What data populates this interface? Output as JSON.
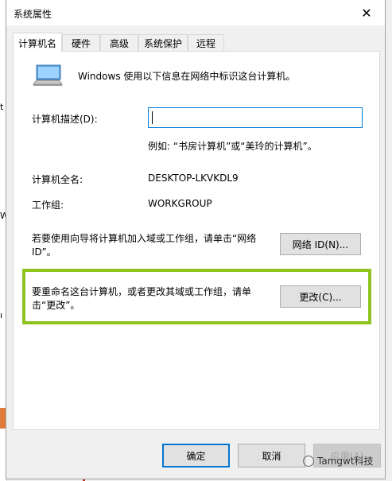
{
  "window": {
    "title": "系统属性",
    "close_glyph": "✕"
  },
  "tabs": [
    {
      "label": "计算机名",
      "active": true
    },
    {
      "label": "硬件",
      "active": false
    },
    {
      "label": "高级",
      "active": false
    },
    {
      "label": "系统保护",
      "active": false
    },
    {
      "label": "远程",
      "active": false
    }
  ],
  "panel": {
    "intro": "Windows 使用以下信息在网络中标识这台计算机。",
    "description_label": "计算机描述(D):",
    "description_value": "",
    "example": "例如: “书房计算机”或“美玲的计算机”。",
    "fullname_label": "计算机全名:",
    "fullname_value": "DESKTOP-LKVKDL9",
    "workgroup_label": "工作组:",
    "workgroup_value": "WORKGROUP",
    "network_text": "若要使用向导将计算机加入域或工作组，请单击“网络 ID”。",
    "network_button": "网络 ID(N)...",
    "rename_text": "要重命名这台计算机，或者更改其域或工作组，请单击“更改”。",
    "change_button": "更改(C)..."
  },
  "footer": {
    "ok": "确定",
    "cancel": "取消",
    "apply": "应用(A)"
  },
  "watermark": "Tamgwt科技",
  "colors": {
    "highlight": "#8fc31f",
    "focus": "#0078d7"
  }
}
